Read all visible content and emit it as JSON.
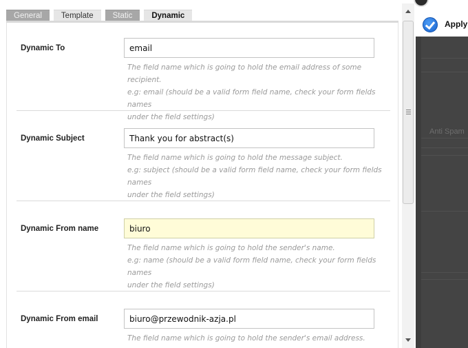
{
  "tabs": [
    {
      "label": "General"
    },
    {
      "label": "Template"
    },
    {
      "label": "Static"
    },
    {
      "label": "Dynamic"
    }
  ],
  "active_tab": "Dynamic",
  "fields": [
    {
      "label": "Dynamic To",
      "value": "email",
      "help": [
        "The field name which is going to hold the email address of some recipient.",
        "e.g: email (should be a valid form field name, check your form fields names",
        "under the field settings)"
      ]
    },
    {
      "label": "Dynamic Subject",
      "value": "Thank you for abstract(s)",
      "help": [
        "The field name which is going to hold the message subject.",
        "e.g: subject (should be a valid form field name, check your form fields names",
        "under the field settings)"
      ]
    },
    {
      "label": "Dynamic From name",
      "value": "biuro",
      "help": [
        "The field name which is going to hold the sender's name.",
        "e.g: name (should be a valid form field name, check your form fields names",
        "under the field settings)"
      ]
    },
    {
      "label": "Dynamic From email",
      "value": "biuro@przewodnik-azja.pl",
      "help": [
        "The field name which is going to hold the sender's email address."
      ]
    }
  ],
  "toolbar": {
    "apply_label": "Apply",
    "apply_icon": "check-circle-icon"
  },
  "background": {
    "antispam_label": "Anti Spam"
  },
  "colors": {
    "focused_input_bg": "#fffcd8",
    "apply_icon": "#1863cf",
    "help_text": "#9a9a9a"
  }
}
